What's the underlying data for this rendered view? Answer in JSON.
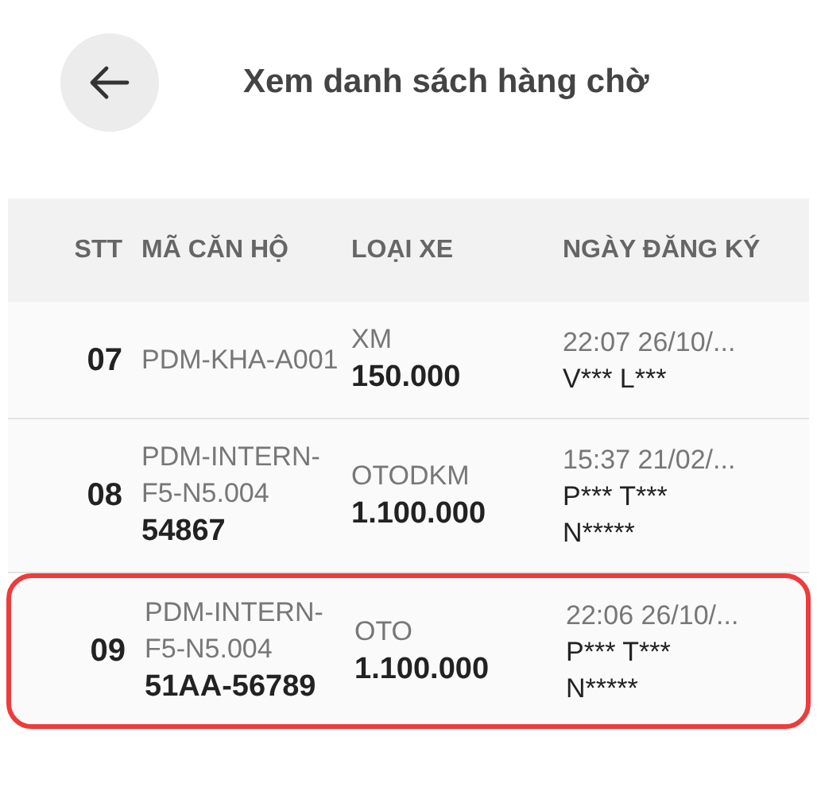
{
  "header": {
    "title": "Xem danh sách hàng chờ"
  },
  "table": {
    "columns": [
      "STT",
      "MÃ CĂN HỘ",
      "LOẠI XE",
      "NGÀY ĐĂNG KÝ"
    ],
    "rows": [
      {
        "stt": "07",
        "apartment": "PDM-KHA-A001",
        "plate": null,
        "vehicle_type": "XM",
        "fee": "150.000",
        "date": "22:07 26/10/...",
        "owner": "V*** L***",
        "selected": false
      },
      {
        "stt": "08",
        "apartment": "PDM-INTERN-F5-N5.004",
        "plate": "54867",
        "vehicle_type": "OTODKM",
        "fee": "1.100.000",
        "date": "15:37 21/02/...",
        "owner": "P*** T*** N*****",
        "selected": false
      },
      {
        "stt": "09",
        "apartment": "PDM-INTERN-F5-N5.004",
        "plate": "51AA-56789",
        "vehicle_type": "OTO",
        "fee": "1.100.000",
        "date": "22:06 26/10/...",
        "owner": "P*** T*** N*****",
        "selected": true
      }
    ]
  }
}
